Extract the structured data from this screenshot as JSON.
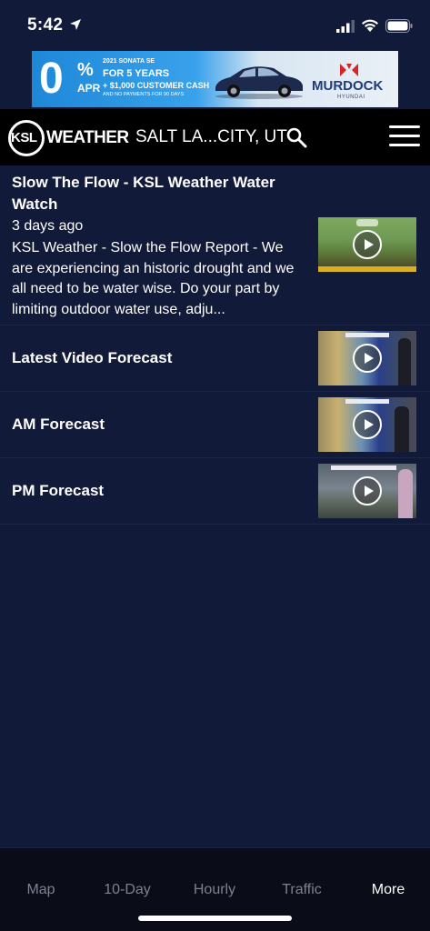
{
  "status_bar": {
    "time": "5:42",
    "icons": [
      "location-arrow-icon",
      "cellular-signal-icon",
      "wifi-icon",
      "battery-icon"
    ]
  },
  "ad": {
    "zero": "0",
    "percent": "%",
    "apr": "APR",
    "line1": "2021 SONATA SE",
    "line2": "FOR 5 YEARS",
    "line3": "+ $1,000 CUSTOMER CASH",
    "line4": "AND NO PAYMENTS FOR 90 DAYS",
    "brand": "MURDOCK",
    "brand_sub": "HYUNDAI"
  },
  "header": {
    "logo_ksl": "KSL",
    "logo_weather": "WEATHER",
    "location": "SALT LA...CITY, UT"
  },
  "items": [
    {
      "title": "Slow The Flow - KSL Weather Water Watch",
      "age": "3 days ago",
      "description": "KSL Weather - Slow the Flow Report - We are experiencing an historic drought and we all need to be water wise.  Do your part by limiting outdoor water use, adju..."
    },
    {
      "title": "Latest Video Forecast"
    },
    {
      "title": "AM Forecast"
    },
    {
      "title": "PM Forecast"
    }
  ],
  "tabs": [
    {
      "label": "Map",
      "active": false
    },
    {
      "label": "10-Day",
      "active": false
    },
    {
      "label": "Hourly",
      "active": false
    },
    {
      "label": "Traffic",
      "active": false
    },
    {
      "label": "More",
      "active": true
    }
  ],
  "colors": {
    "background": "#121a3a",
    "header": "#000000",
    "tabbar": "#0a0d17",
    "tab_inactive": "#7d8191",
    "tab_active": "#ffffff"
  }
}
